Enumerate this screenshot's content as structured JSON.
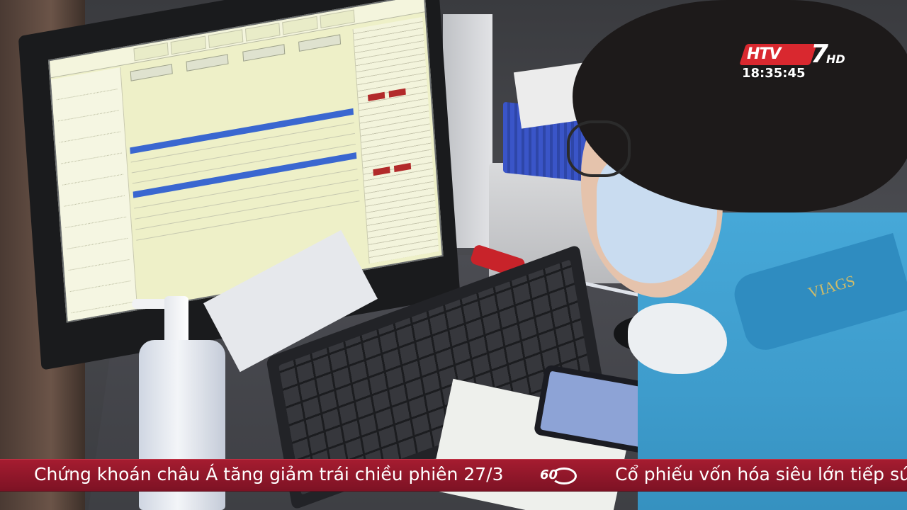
{
  "broadcast": {
    "channel_logo": "HTV7",
    "channel_logo_suffix": "HD",
    "clock": "18:35:45"
  },
  "ticker": {
    "headline_1": "Chứng khoán châu Á tăng giảm trái chiều phiên 27/3",
    "separator_badge": "60",
    "headline_2": "Cổ phiếu vốn hóa siêu lớn tiếp sức"
  },
  "scene": {
    "description_icons": [
      "monitor-icon",
      "keyboard-icon",
      "sanitizer-bottle-icon",
      "phone-icon",
      "mouse-icon"
    ],
    "colors": {
      "ticker_bg": "#a51c30",
      "logo_red": "#d9282f",
      "shirt_blue": "#46a8d8",
      "screen_bg": "#eef0c8",
      "highlight_bar": "#3a67d0"
    }
  }
}
